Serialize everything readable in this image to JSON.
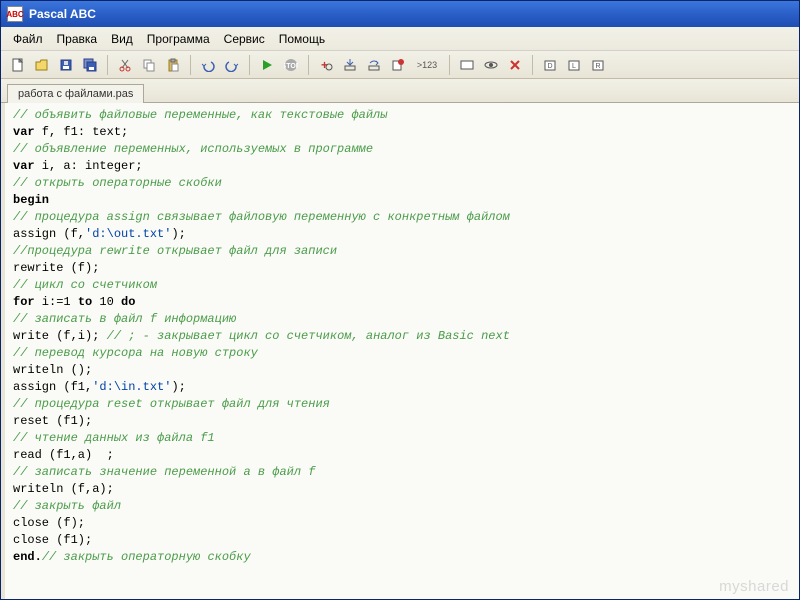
{
  "title": "Pascal ABC",
  "app_icon_text": "ABC",
  "menu": {
    "file": "Файл",
    "edit": "Правка",
    "view": "Вид",
    "program": "Программа",
    "service": "Сервис",
    "help": "Помощь"
  },
  "toolbar": {
    "step_label": ">123"
  },
  "tab": {
    "filename": "работа с файлами.pas"
  },
  "code": {
    "lines": [
      {
        "cls": "c-comment",
        "t": "// объявить файловые переменные, как текстовые файлы"
      },
      {
        "segments": [
          {
            "cls": "c-keyword",
            "t": "var"
          },
          {
            "cls": "c-plain",
            "t": " f, f1: text;"
          }
        ]
      },
      {
        "cls": "c-comment",
        "t": "// объявление переменных, используемых в программе"
      },
      {
        "segments": [
          {
            "cls": "c-keyword",
            "t": "var"
          },
          {
            "cls": "c-plain",
            "t": " i, a: integer;"
          }
        ]
      },
      {
        "cls": "c-comment",
        "t": "// открыть операторные скобки"
      },
      {
        "cls": "c-keyword",
        "t": "begin"
      },
      {
        "cls": "c-comment",
        "t": "// процедура assign связывает файловую переменную с конкретным файлом"
      },
      {
        "segments": [
          {
            "cls": "c-plain",
            "t": "assign (f,"
          },
          {
            "cls": "c-string",
            "t": "'d:\\out.txt'"
          },
          {
            "cls": "c-plain",
            "t": ");"
          }
        ]
      },
      {
        "cls": "c-comment",
        "t": "//процедура rewrite открывает файл для записи"
      },
      {
        "cls": "c-plain",
        "t": "rewrite (f);"
      },
      {
        "cls": "c-comment",
        "t": "// цикл со счетчиком"
      },
      {
        "segments": [
          {
            "cls": "c-keyword",
            "t": "for"
          },
          {
            "cls": "c-plain",
            "t": " i:=1 "
          },
          {
            "cls": "c-keyword",
            "t": "to"
          },
          {
            "cls": "c-plain",
            "t": " 10 "
          },
          {
            "cls": "c-keyword",
            "t": "do"
          }
        ]
      },
      {
        "cls": "c-comment",
        "t": "// записать в файл f информацию"
      },
      {
        "segments": [
          {
            "cls": "c-plain",
            "t": "write (f,i); "
          },
          {
            "cls": "c-comment",
            "t": "// ; - закрывает цикл со счетчиком, аналог из Basic next"
          }
        ]
      },
      {
        "cls": "c-comment",
        "t": "// перевод курсора на новую строку"
      },
      {
        "cls": "c-plain",
        "t": "writeln ();"
      },
      {
        "segments": [
          {
            "cls": "c-plain",
            "t": "assign (f1,"
          },
          {
            "cls": "c-string",
            "t": "'d:\\in.txt'"
          },
          {
            "cls": "c-plain",
            "t": ");"
          }
        ]
      },
      {
        "cls": "c-comment",
        "t": "// процедура reset открывает файл для чтения"
      },
      {
        "cls": "c-plain",
        "t": "reset (f1);"
      },
      {
        "cls": "c-comment",
        "t": "// чтение данных из файла f1"
      },
      {
        "cls": "c-plain",
        "t": "read (f1,a)  ;"
      },
      {
        "cls": "c-comment",
        "t": "// записать значение переменной a в файл f"
      },
      {
        "cls": "c-plain",
        "t": "writeln (f,a);"
      },
      {
        "cls": "c-comment",
        "t": "// закрыть файл"
      },
      {
        "cls": "c-plain",
        "t": "close (f);"
      },
      {
        "cls": "c-plain",
        "t": "close (f1);"
      },
      {
        "segments": [
          {
            "cls": "c-keyword",
            "t": "end."
          },
          {
            "cls": "c-comment",
            "t": "// закрыть операторную скобку"
          }
        ]
      }
    ]
  },
  "watermark": "myshared"
}
